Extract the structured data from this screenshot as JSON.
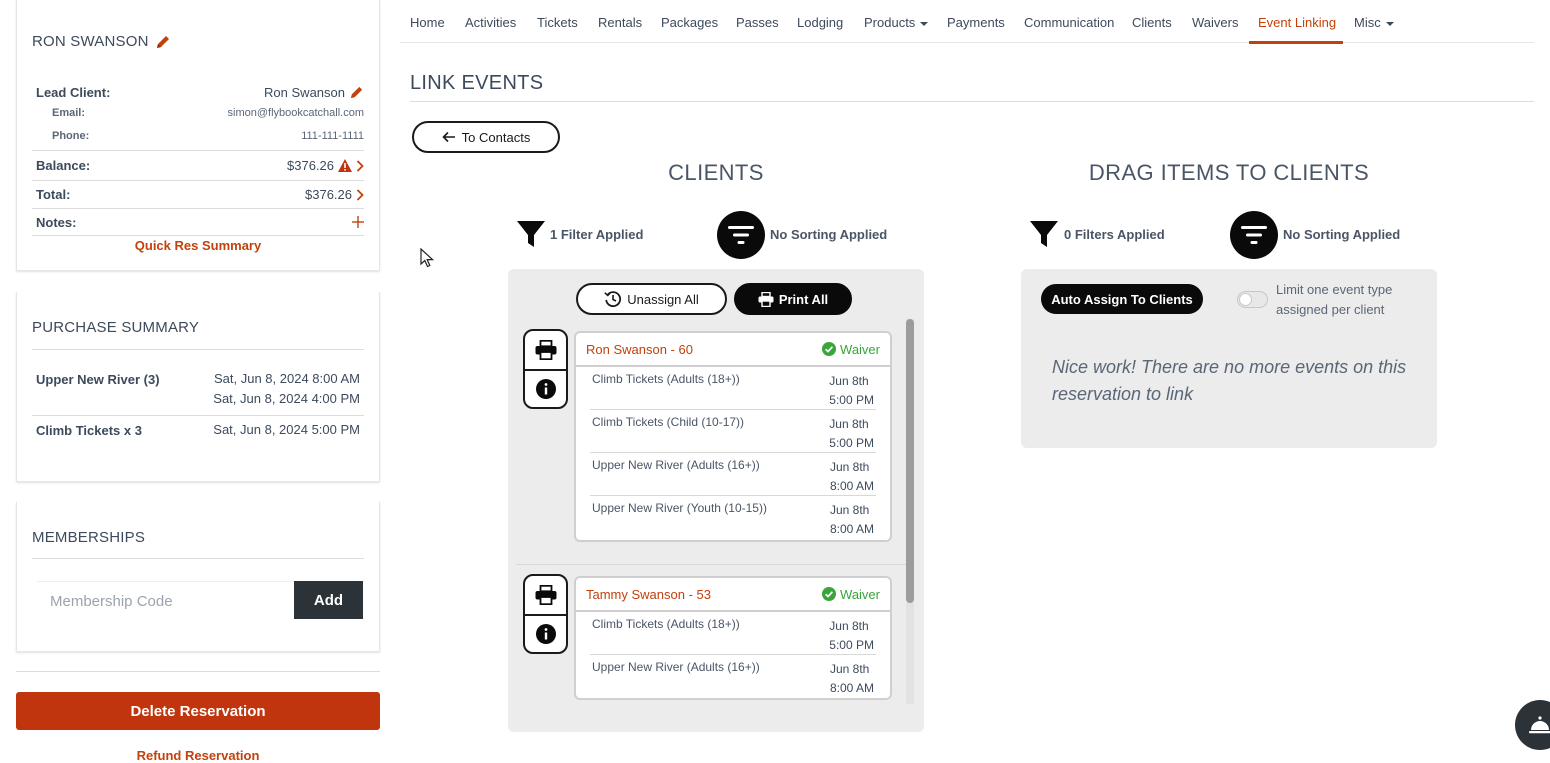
{
  "reservation": {
    "name": "RON SWANSON",
    "lead_client_label": "Lead Client:",
    "lead_client_value": "Ron Swanson",
    "email_label": "Email:",
    "email_value": "simon@flybookcatchall.com",
    "phone_label": "Phone:",
    "phone_value": "111-111-1111",
    "balance_label": "Balance:",
    "balance_value": "$376.26",
    "total_label": "Total:",
    "total_value": "$376.26",
    "notes_label": "Notes:",
    "quick_res_label": "Quick Res Summary"
  },
  "purchase_summary": {
    "title": "PURCHASE SUMMARY",
    "items": [
      {
        "name": "Upper New River (3)",
        "dates": [
          "Sat, Jun 8, 2024 8:00 AM",
          "Sat, Jun 8, 2024 4:00 PM"
        ]
      },
      {
        "name": "Climb Tickets x 3",
        "dates": [
          "Sat, Jun 8, 2024 5:00 PM"
        ]
      }
    ]
  },
  "memberships": {
    "title": "MEMBERSHIPS",
    "placeholder": "Membership Code",
    "add_label": "Add"
  },
  "delete_label": "Delete Reservation",
  "refund_label": "Refund Reservation",
  "nav": {
    "items": [
      "Home",
      "Activities",
      "Tickets",
      "Rentals",
      "Packages",
      "Passes",
      "Lodging",
      "Products",
      "Payments",
      "Communication",
      "Clients",
      "Waivers",
      "Event Linking",
      "Misc"
    ],
    "active": "Event Linking"
  },
  "page": {
    "title": "LINK EVENTS",
    "back_label": "To Contacts"
  },
  "clients_section": {
    "title": "CLIENTS",
    "filter_label": "1 Filter Applied",
    "sort_label": "No Sorting Applied",
    "unassign_label": "Unassign All",
    "print_label": "Print All",
    "clients": [
      {
        "name": "Ron Swanson - 60",
        "waiver": "Waiver",
        "events": [
          {
            "name": "Climb Tickets (Adults (18+))",
            "date": "Jun 8th",
            "time": "5:00 PM"
          },
          {
            "name": "Climb Tickets (Child (10-17))",
            "date": "Jun 8th",
            "time": "5:00 PM"
          },
          {
            "name": "Upper New River (Adults (16+))",
            "date": "Jun 8th",
            "time": "8:00 AM"
          },
          {
            "name": "Upper New River (Youth (10-15))",
            "date": "Jun 8th",
            "time": "8:00 AM"
          }
        ]
      },
      {
        "name": "Tammy Swanson - 53",
        "waiver": "Waiver",
        "events": [
          {
            "name": "Climb Tickets (Adults (18+))",
            "date": "Jun 8th",
            "time": "5:00 PM"
          },
          {
            "name": "Upper New River (Adults (16+))",
            "date": "Jun 8th",
            "time": "8:00 AM"
          }
        ]
      }
    ]
  },
  "items_section": {
    "title": "DRAG ITEMS TO CLIENTS",
    "filter_label": "0 Filters Applied",
    "sort_label": "No Sorting Applied",
    "auto_assign_label": "Auto Assign To Clients",
    "limit_label": "Limit one event type assigned per client",
    "empty_message": "Nice work! There are no more events on this reservation to link"
  },
  "colors": {
    "accent": "#c2410c",
    "waiver_green": "#3aa53a",
    "dark": "#0a0a0a",
    "panel_bg": "#ececec"
  }
}
